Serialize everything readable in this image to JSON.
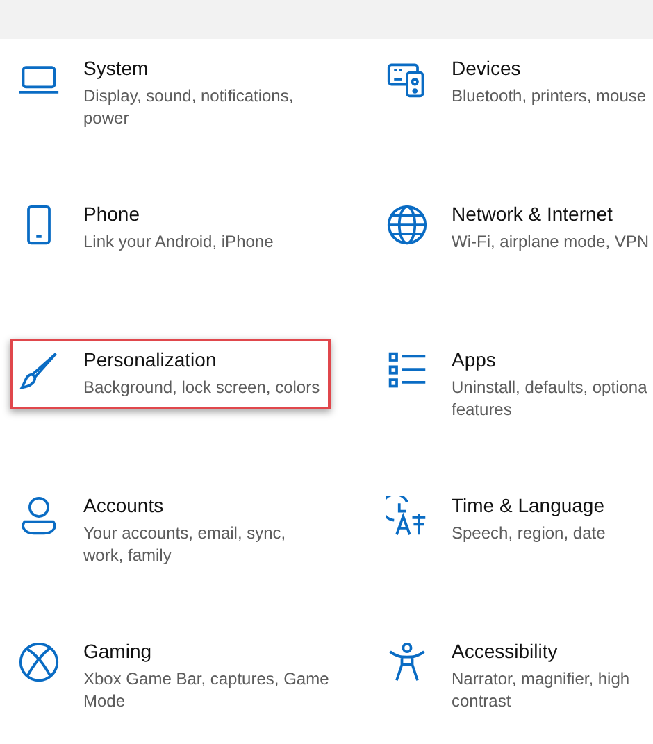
{
  "categories": [
    {
      "title": "System",
      "description": "Display, sound, notifications,\npower",
      "highlighted": false
    },
    {
      "title": "Devices",
      "description": "Bluetooth, printers, mouse",
      "highlighted": false
    },
    {
      "title": "Phone",
      "description": "Link your Android, iPhone",
      "highlighted": false
    },
    {
      "title": "Network & Internet",
      "description": "Wi-Fi, airplane mode, VPN",
      "highlighted": false
    },
    {
      "title": "Personalization",
      "description": "Background, lock screen, colors",
      "highlighted": true
    },
    {
      "title": "Apps",
      "description": "Uninstall, defaults, optiona\nfeatures",
      "highlighted": false
    },
    {
      "title": "Accounts",
      "description": "Your accounts, email, sync,\nwork, family",
      "highlighted": false
    },
    {
      "title": "Time & Language",
      "description": "Speech, region, date",
      "highlighted": false
    },
    {
      "title": "Gaming",
      "description": "Xbox Game Bar, captures, Game\nMode",
      "highlighted": false
    },
    {
      "title": "Accessibility",
      "description": "Narrator, magnifier, high\ncontrast",
      "highlighted": false
    }
  ]
}
